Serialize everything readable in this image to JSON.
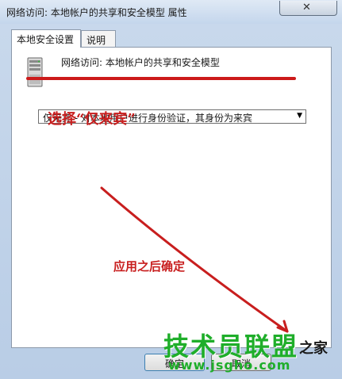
{
  "window": {
    "title": "网络访问: 本地帐户的共享和安全模型 属性",
    "close_label": "✕"
  },
  "tabs": [
    {
      "label": "本地安全设置",
      "active": true
    },
    {
      "label": "说明",
      "active": false
    }
  ],
  "policy": {
    "name": "网络访问: 本地帐户的共享和安全模型",
    "icon": "server-icon"
  },
  "dropdown": {
    "selected": "仅来宾 - 对本地用户进行身份验证，其身份为来宾",
    "arrow": "▼"
  },
  "annotations": {
    "select_hint": "选择“仅来宾”",
    "confirm_hint": "应用之后确定",
    "color": "#c81e1e"
  },
  "buttons": {
    "ok": "确定",
    "cancel": "取消"
  },
  "watermark": {
    "text": "技术员联盟",
    "url": "www.jsgho.com",
    "suffix": "之家",
    "color": "#1fae2a"
  }
}
